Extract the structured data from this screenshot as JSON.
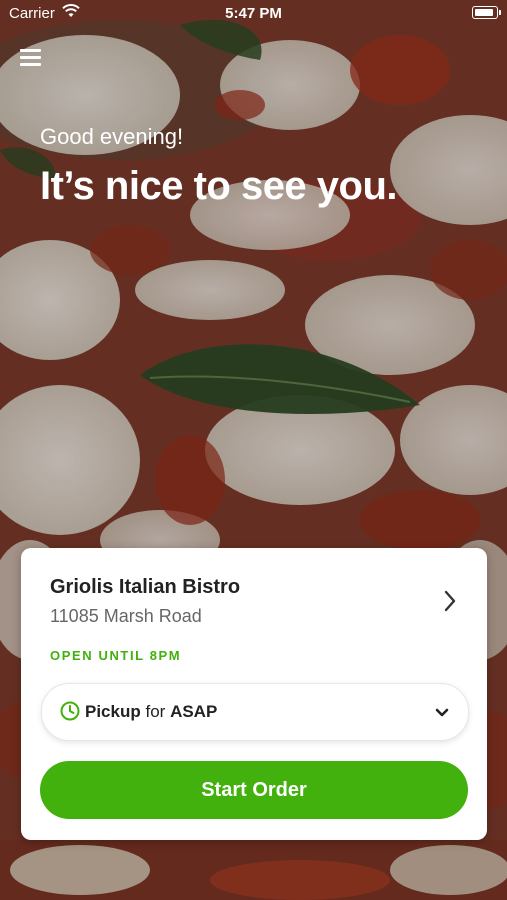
{
  "status_bar": {
    "carrier": "Carrier",
    "time": "5:47 PM",
    "battery_level": 1.0
  },
  "greeting": {
    "salutation": "Good evening!",
    "headline": "It’s nice to see you."
  },
  "restaurant": {
    "name": "Griolis Italian Bistro",
    "address": "11085 Marsh Road",
    "hours_status": "OPEN UNTIL 8PM"
  },
  "order_mode": {
    "method": "Pickup",
    "connector": "for",
    "time": "ASAP"
  },
  "start_button": {
    "label": "Start Order"
  },
  "colors": {
    "accent": "#42b00d",
    "card_bg": "#ffffff",
    "text_primary": "#222222",
    "text_secondary": "#666666"
  },
  "icons": {
    "menu": "hamburger-icon",
    "wifi": "wifi-icon",
    "battery": "battery-icon",
    "detail": "chevron-right-icon",
    "clock": "clock-icon",
    "dropdown": "chevron-down-icon"
  }
}
